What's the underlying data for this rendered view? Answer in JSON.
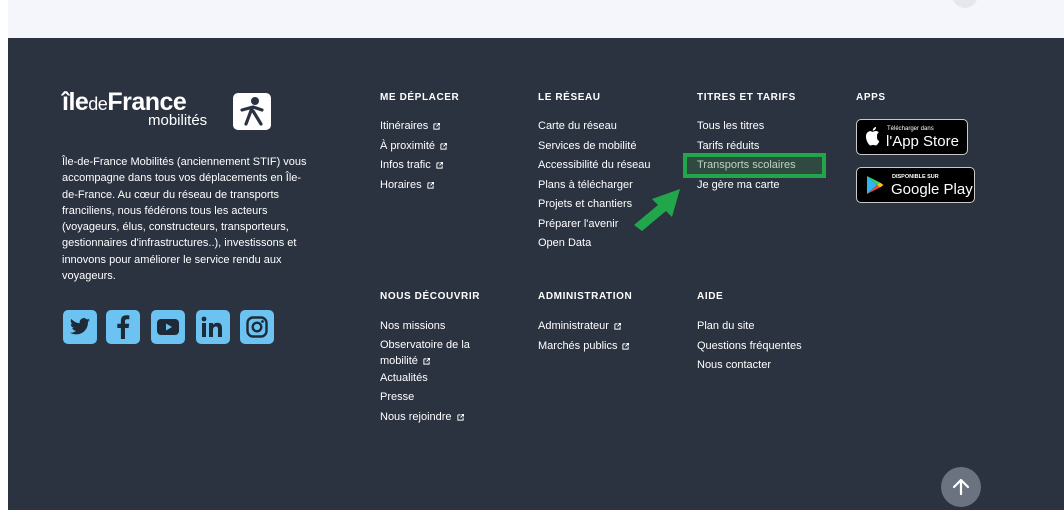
{
  "brand": {
    "name_ile": "île",
    "name_de": "de",
    "name_france": "France",
    "name_sub": "mobilités"
  },
  "description": "Île-de-France Mobilités (anciennement STIF) vous accompagne dans tous vos déplacements en Île-de-France. Au cœur du réseau de transports franciliens, nous fédérons tous les acteurs (voyageurs, élus, constructeurs, transporteurs, gestionnaires d'infrastructures..), investissons et innovons pour améliorer le service rendu aux voyageurs.",
  "socials": [
    "twitter-icon",
    "facebook-icon",
    "youtube-icon",
    "linkedin-icon",
    "instagram-icon"
  ],
  "columns": {
    "me_deplacer": {
      "title": "ME DÉPLACER",
      "items": [
        "Itinéraires",
        "À proximité",
        "Infos trafic",
        "Horaires"
      ]
    },
    "le_reseau": {
      "title": "LE RÉSEAU",
      "items": [
        "Carte du réseau",
        "Services de mobilité",
        "Accessibilité du réseau",
        "Plans à télécharger",
        "Projets et chantiers",
        "Préparer l'avenir",
        "Open Data"
      ]
    },
    "titres": {
      "title": "TITRES ET TARIFS",
      "items": [
        "Tous les titres",
        "Tarifs réduits",
        "Transports scolaires",
        "Je gère ma carte"
      ]
    },
    "apps": {
      "title": "APPS",
      "app_store_small": "Télécharger dans",
      "app_store_big": "l'App Store",
      "google_small": "DISPONIBLE SUR",
      "google_big": "Google Play"
    },
    "nous_decouvrir": {
      "title": "NOUS DÉCOUVRIR",
      "items": [
        "Nos missions",
        "Observatoire de la",
        "mobilité",
        "Actualités",
        "Presse",
        "Nous rejoindre"
      ]
    },
    "administration": {
      "title": "ADMINISTRATION",
      "items": [
        "Administrateur",
        "Marchés publics"
      ]
    },
    "aide": {
      "title": "AIDE",
      "items": [
        "Plan du site",
        "Questions fréquentes",
        "Nous contacter"
      ]
    }
  },
  "colors": {
    "footer_bg": "#2b3240",
    "social_bg": "#6cc3f2",
    "highlight": "#21a64b"
  }
}
